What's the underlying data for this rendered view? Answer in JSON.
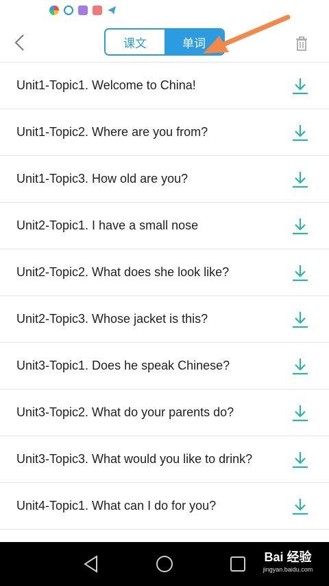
{
  "header": {
    "tabs": [
      {
        "label": "课文",
        "active": false
      },
      {
        "label": "单词",
        "active": true
      }
    ]
  },
  "lessons": [
    {
      "title": "Unit1-Topic1. Welcome to China!"
    },
    {
      "title": "Unit1-Topic2. Where are you from?"
    },
    {
      "title": "Unit1-Topic3. How old are you?"
    },
    {
      "title": "Unit2-Topic1. I have a small nose"
    },
    {
      "title": "Unit2-Topic2. What does she look like?"
    },
    {
      "title": "Unit2-Topic3. Whose jacket is this?"
    },
    {
      "title": "Unit3-Topic1. Does he speak Chinese?"
    },
    {
      "title": "Unit3-Topic2. What do your parents do?"
    },
    {
      "title": "Unit3-Topic3. What would you like to drink?"
    },
    {
      "title": "Unit4-Topic1. What can I do for you?"
    }
  ],
  "watermark": {
    "brand": "Bai 经验",
    "url": "jingyan.baidu.com"
  },
  "colors": {
    "accent": "#2d9be0",
    "download": "#2bb3a3",
    "annotation_arrow": "#f0894a"
  },
  "icons": {
    "back": "chevron-left",
    "trash": "trash",
    "download": "download-arrow",
    "nav": [
      "triangle-back",
      "circle-home",
      "square-recents"
    ]
  }
}
